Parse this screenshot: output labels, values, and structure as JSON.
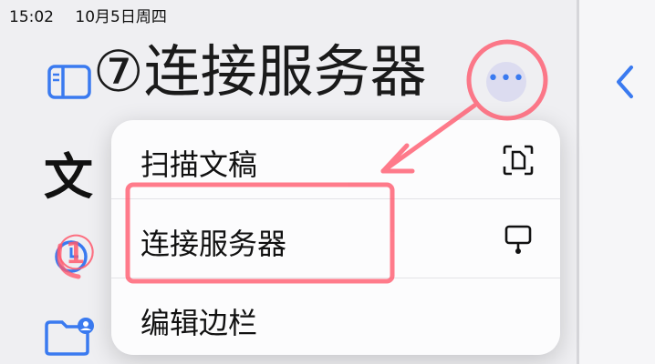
{
  "status_bar": {
    "time": "15:02",
    "date": "10月5日周四"
  },
  "sidebar": {
    "title_partial": "文"
  },
  "menu": {
    "items": [
      {
        "label": "扫描文稿",
        "icon": "scan-document-icon"
      },
      {
        "label": "连接服务器",
        "icon": "server-display-icon"
      },
      {
        "label": "编辑边栏",
        "icon": ""
      }
    ]
  },
  "annotations": {
    "header_note": "⑦连接服务器",
    "side_note": "①",
    "ink_color": "#1a1a1a",
    "mark_color": "#ff5a6e"
  },
  "colors": {
    "accent": "#3a7af0",
    "menu_bg": "#fcfcfd",
    "pane_bg": "#efeff2"
  }
}
